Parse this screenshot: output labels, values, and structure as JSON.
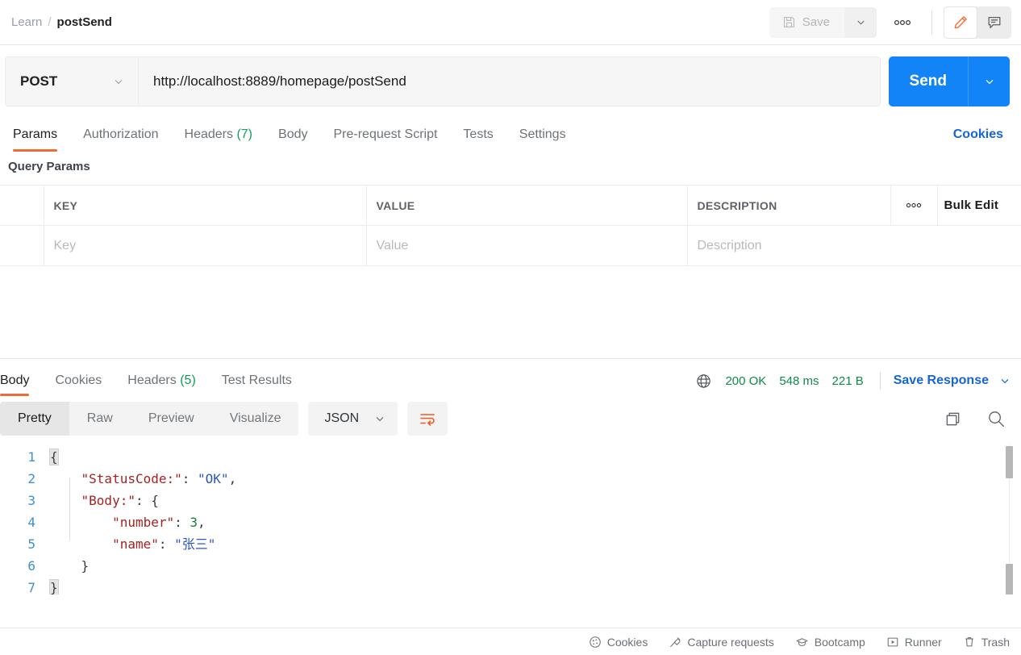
{
  "header": {
    "collection": "Learn",
    "separator": "/",
    "request_name": "postSend",
    "save_label": "Save",
    "icons": {
      "save": "floppy-disk-icon",
      "save_caret": "chevron-down-icon",
      "more": "ellipsis-icon",
      "edit": "pencil-icon",
      "comment": "comment-icon"
    },
    "accent_orange": "#ef6c35"
  },
  "url_bar": {
    "method": "POST",
    "url": "http://localhost:8889/homepage/postSend",
    "send_label": "Send",
    "send_color": "#1284f7"
  },
  "request_tabs": [
    {
      "label": "Params",
      "count": "",
      "active": true
    },
    {
      "label": "Authorization",
      "count": "",
      "active": false
    },
    {
      "label": "Headers",
      "count": "(7)",
      "active": false
    },
    {
      "label": "Body",
      "count": "",
      "active": false
    },
    {
      "label": "Pre-request Script",
      "count": "",
      "active": false
    },
    {
      "label": "Tests",
      "count": "",
      "active": false
    },
    {
      "label": "Settings",
      "count": "",
      "active": false
    }
  ],
  "cookies_link": "Cookies",
  "query_params": {
    "title": "Query Params",
    "columns": [
      "KEY",
      "VALUE",
      "DESCRIPTION"
    ],
    "dots": "•••",
    "bulk_edit": "Bulk Edit",
    "empty_row": {
      "key_placeholder": "Key",
      "value_placeholder": "Value",
      "description_placeholder": "Description"
    }
  },
  "response": {
    "tabs": [
      {
        "label": "Body",
        "count": "",
        "active": true
      },
      {
        "label": "Cookies",
        "count": "",
        "active": false
      },
      {
        "label": "Headers",
        "count": "(5)",
        "active": false
      },
      {
        "label": "Test Results",
        "count": "",
        "active": false
      }
    ],
    "status": "200 OK",
    "time": "548 ms",
    "size": "221 B",
    "status_color": "#0f8a4a",
    "save_response": "Save Response",
    "globe_icon": "globe-icon",
    "format_tabs": [
      {
        "label": "Pretty",
        "active": true
      },
      {
        "label": "Raw",
        "active": false
      },
      {
        "label": "Preview",
        "active": false
      },
      {
        "label": "Visualize",
        "active": false
      }
    ],
    "language": "JSON",
    "wrap_icon": "word-wrap-icon",
    "copy_icon": "copy-icon",
    "search_icon": "search-icon",
    "body_lines": [
      {
        "n": "1",
        "html": "<span class=\"p brace-hl\">{</span>"
      },
      {
        "n": "2",
        "html": "    <span class=\"k\">\"StatusCode:\"</span><span class=\"p\">: </span><span class=\"s\">\"OK\"</span><span class=\"p\">,</span>"
      },
      {
        "n": "3",
        "html": "    <span class=\"k\">\"Body:\"</span><span class=\"p\">: </span><span class=\"p\">{</span>"
      },
      {
        "n": "4",
        "html": "        <span class=\"k\">\"number\"</span><span class=\"p\">: </span><span class=\"n\">3</span><span class=\"p\">,</span>"
      },
      {
        "n": "5",
        "html": "        <span class=\"k\">\"name\"</span><span class=\"p\">: </span><span class=\"s\">\"张三\"</span>"
      },
      {
        "n": "6",
        "html": "    <span class=\"p\">}</span>"
      },
      {
        "n": "7",
        "html": "<span class=\"p brace-hl\">}</span>"
      }
    ],
    "body_text": "{\n    \"StatusCode:\": \"OK\",\n    \"Body:\": {\n        \"number\": 3,\n        \"name\": \"张三\"\n    }\n}"
  },
  "footer": [
    {
      "label": "Cookies",
      "icon": "cookie-icon"
    },
    {
      "label": "Capture requests",
      "icon": "satellite-icon"
    },
    {
      "label": "Bootcamp",
      "icon": "graduation-cap-icon"
    },
    {
      "label": "Runner",
      "icon": "play-box-icon"
    },
    {
      "label": "Trash",
      "icon": "trash-icon"
    }
  ]
}
